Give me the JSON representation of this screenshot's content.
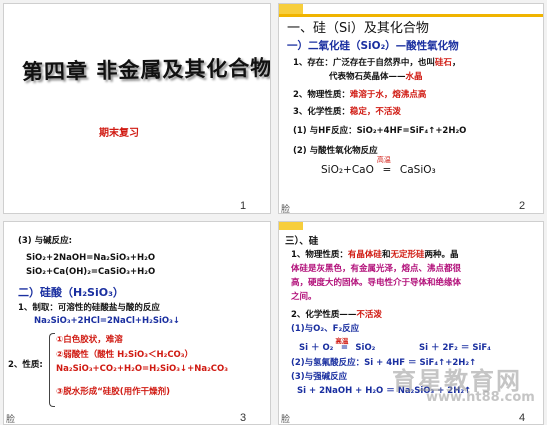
{
  "slide1": {
    "title": "第四章 非金属及其化合物",
    "subtitle": "期末复习",
    "page": "1"
  },
  "slide2": {
    "heading": "一、硅（Si）及其化合物",
    "subheading": "一）二氧化硅（SiO₂）—酸性氧化物",
    "l1a": "1、存在：广泛存在于自然界中，也叫",
    "l1a_red": "硅石",
    "l1b": "代表物石英晶体——",
    "l1b_red": "水晶",
    "l2": "2、物理性质：",
    "l2_red": "难溶于水，熔沸点高",
    "l3": "3、化学性质：",
    "l3_red": "稳定，不活泼",
    "l4": "(1) 与HF反应：SiO₂+4HF=SiF₄↑+2H₂O",
    "l5": "(2) 与酸性氧化物反应",
    "eq_left": "SiO₂+CaO",
    "eq_cond": "高温",
    "eq_right": "CaSiO₃",
    "page": "2",
    "corner": "脸"
  },
  "slide3": {
    "l1": "(3) 与碱反应:",
    "l2": "SiO₂+2NaOH=Na₂SiO₃+H₂O",
    "l3": "SiO₂+Ca(OH)₂=CaSiO₃+H₂O",
    "h2": "二）硅酸（H₂SiO₃）",
    "l4": "1、制取：可溶性的硅酸盐与酸的反应",
    "l5": "Na₂SiO₃+2HCl=2NaCl+H₂SiO₃↓",
    "prop_label": "2、性质:",
    "p1": "①白色胶状，难溶",
    "p2": "②弱酸性（酸性 H₂SiO₃＜H₂CO₃）",
    "p3": "Na₂SiO₃+CO₂+H₂O=H₂SiO₃↓+Na₂CO₃",
    "p4": "③脱水形成“硅胶(用作干燥剂)",
    "page": "3",
    "corner": "脸"
  },
  "slide4": {
    "h": "三）、硅",
    "l1": "1、物理性质：",
    "l1_red1": "有晶体硅",
    "l1_mid": "和",
    "l1_red2": "无定形硅",
    "l1_tail": "两种。晶",
    "l2": "体硅是灰黑色，有金属光泽，熔点、沸点都很",
    "l3": "高，硬度大的固体。导电性介于导体和绝缘体",
    "l4": "之间。",
    "l5": "2、化学性质——",
    "l5_red": "不活泼",
    "l6": "(1)与O₂、F₂反应",
    "l7a": "Si ＋ O₂",
    "l7cond": "高温",
    "l7b": "SiO₂",
    "l7c": "Si ＋ 2F₂ ＝ SiF₄",
    "l8": "(2)与氢氟酸反应：Si + 4HF ＝ SiF₄↑+2H₂↑",
    "l9": "(3)与强碱反应",
    "l10": "Si + 2NaOH + H₂O ＝ Na₂SiO₃ + 2H₂↑",
    "page": "4",
    "corner": "脸"
  },
  "watermark": {
    "name": "育星教育网",
    "url": "www.ht88.com"
  }
}
